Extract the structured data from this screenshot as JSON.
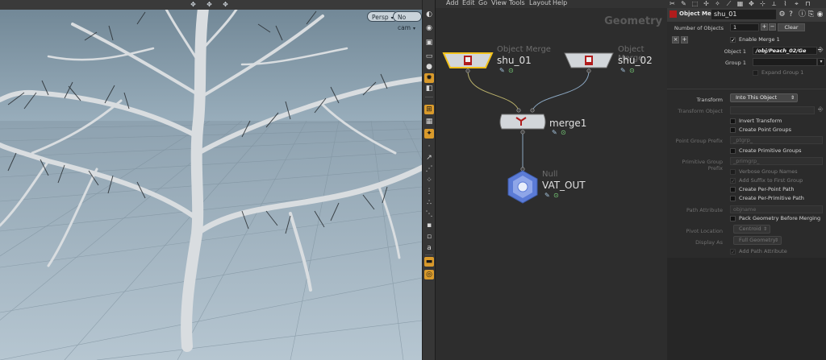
{
  "viewport": {
    "camera_menu": "Persp",
    "cam_menu": "No cam",
    "toolbar_icons": [
      "ghost-icon",
      "lock-icon",
      "display-icon",
      "light-icon",
      "snap-icon",
      "home-icon",
      "frame-icon",
      "cube-icon",
      "sphere-icon",
      "wire-icon",
      "point-icon",
      "grid-icon",
      "render-icon",
      "camera-icon",
      "flipbook-icon"
    ]
  },
  "network": {
    "menus": [
      "Add",
      "Edit",
      "Go",
      "View",
      "Tools",
      "Layout",
      "Help"
    ],
    "context_label": "Geometry",
    "nodes": [
      {
        "type": "Object Merge",
        "name": "shu_01"
      },
      {
        "type": "Object Merge",
        "name": "shu_02"
      },
      {
        "type": "",
        "name": "merge1"
      },
      {
        "type": "Null",
        "name": "VAT_OUT"
      }
    ]
  },
  "params": {
    "node_type": "Object Merge",
    "node_name": "shu_01",
    "number_of_objects_label": "Number of Objects",
    "number_of_objects": "1",
    "clear_label": "Clear",
    "enable_merge_label": "Enable Merge 1",
    "object1_label": "Object 1",
    "object1_value": "/obj/Peach_02/Ge",
    "group1_label": "Group 1",
    "expand_group_label": "Expand Group 1",
    "transform_label": "Transform",
    "transform_value": "Into This Object",
    "transform_object_label": "Transform Object",
    "invert_transform_label": "Invert Transform",
    "create_point_groups_label": "Create Point Groups",
    "point_group_prefix_label": "Point Group Prefix",
    "point_group_prefix_value": "_ptgrp_",
    "create_primitive_groups_label": "Create Primitive Groups",
    "primitive_group_prefix_label": "Primitive Group Prefix",
    "primitive_group_prefix_value": "_primgrp_",
    "verbose_group_names_label": "Verbose Group Names",
    "add_suffix_label": "Add Suffix to First Group",
    "create_per_point_path_label": "Create Per-Point Path",
    "create_per_primitive_path_label": "Create Per-Primitive Path",
    "path_attribute_label": "Path Attribute",
    "path_attribute_value": "objname",
    "pack_geometry_label": "Pack Geometry Before Merging",
    "pivot_location_label": "Pivot Location",
    "pivot_location_value": "Centroid",
    "display_as_label": "Display As",
    "display_as_value": "Full Geometry",
    "add_path_attribute_label": "Add Path Attribute"
  },
  "colors": {
    "selected_node": "#f2c21b",
    "toolbar_highlight": "#d99a2b",
    "wire": "#8aa6c0"
  }
}
